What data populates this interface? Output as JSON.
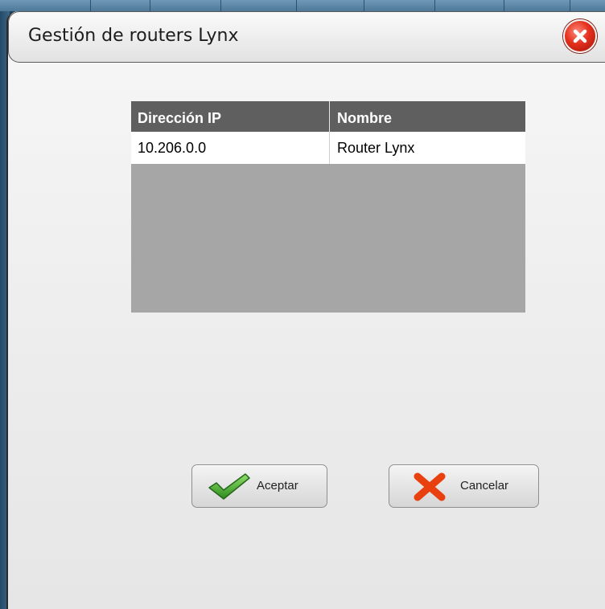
{
  "dialog": {
    "title": "Gestión de routers Lynx",
    "close_icon": "close-icon",
    "close_color": "#e5301d"
  },
  "table": {
    "columns": [
      "Dirección IP",
      "Nombre"
    ],
    "rows": [
      {
        "ip": "10.206.0.0",
        "name": "Router Lynx"
      }
    ],
    "header_color": "#5f5f5f",
    "empty_area_color": "#a6a6a6"
  },
  "buttons": {
    "accept_label": "Aceptar",
    "accept_icon": "checkmark-icon",
    "cancel_label": "Cancelar",
    "cancel_icon": "cross-icon"
  }
}
